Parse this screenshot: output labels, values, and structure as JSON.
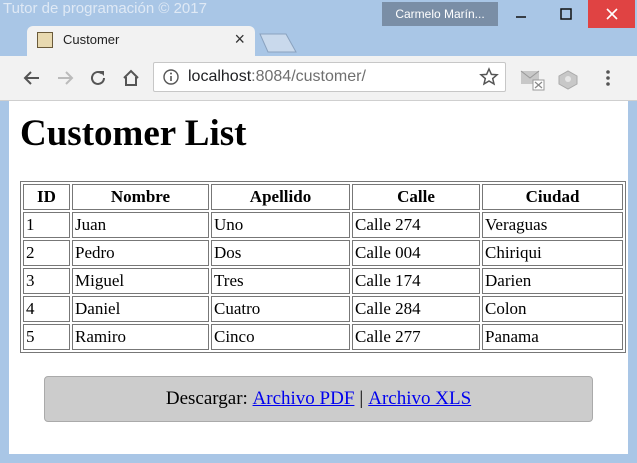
{
  "window": {
    "watermark": "Tutor de programación © 2017",
    "user": "Carmelo Marín...",
    "minimize_label": "—",
    "maximize_label": "☐",
    "close_label": "✕"
  },
  "tab": {
    "title": "Customer",
    "close": "×"
  },
  "address": {
    "host": "localhost",
    "rest": ":8084/customer/"
  },
  "page": {
    "heading": "Customer List",
    "table": {
      "headers": [
        "ID",
        "Nombre",
        "Apellido",
        "Calle",
        "Ciudad"
      ],
      "rows": [
        [
          "1",
          "Juan",
          "Uno",
          "Calle 274",
          "Veraguas"
        ],
        [
          "2",
          "Pedro",
          "Dos",
          "Calle 004",
          "Chiriqui"
        ],
        [
          "3",
          "Miguel",
          "Tres",
          "Calle 174",
          "Darien"
        ],
        [
          "4",
          "Daniel",
          "Cuatro",
          "Calle 284",
          "Colon"
        ],
        [
          "5",
          "Ramiro",
          "Cinco",
          "Calle 277",
          "Panama"
        ]
      ]
    },
    "download": {
      "label": "Descargar:",
      "pdf_link": "Archivo PDF",
      "separator": "|",
      "xls_link": "Archivo XLS"
    }
  },
  "colors": {
    "titlebar": "#a9c6e6",
    "close_red": "#e04343",
    "link": "#0000ee",
    "download_bg": "#cccccc"
  }
}
